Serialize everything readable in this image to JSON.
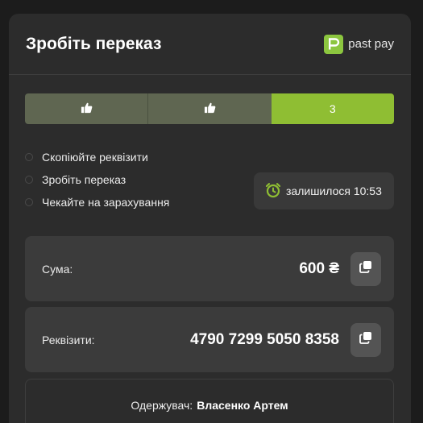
{
  "header": {
    "title": "Зробіть переказ",
    "brand_name": "past pay",
    "brand_color": "#8cc63f"
  },
  "steps": [
    {
      "state": "done",
      "icon": "thumbs-up-icon"
    },
    {
      "state": "done",
      "icon": "thumbs-up-icon"
    },
    {
      "state": "active",
      "label": "3"
    }
  ],
  "checklist": [
    "Скопіюйте реквізити",
    "Зробіть переказ",
    "Чекайте на зарахування"
  ],
  "timer": {
    "icon": "alarm-clock-icon",
    "label": "залишилося 10:53"
  },
  "amount": {
    "label": "Сума:",
    "value": "600 ₴"
  },
  "details": {
    "label": "Реквізити:",
    "value": "4790 7299 5050 8358"
  },
  "recipient": {
    "label": "Одержувач:",
    "name": "Власенко Артем"
  },
  "colors": {
    "accent": "#8fbe33",
    "done_step": "#5f6651",
    "card": "#2c2c2c"
  }
}
